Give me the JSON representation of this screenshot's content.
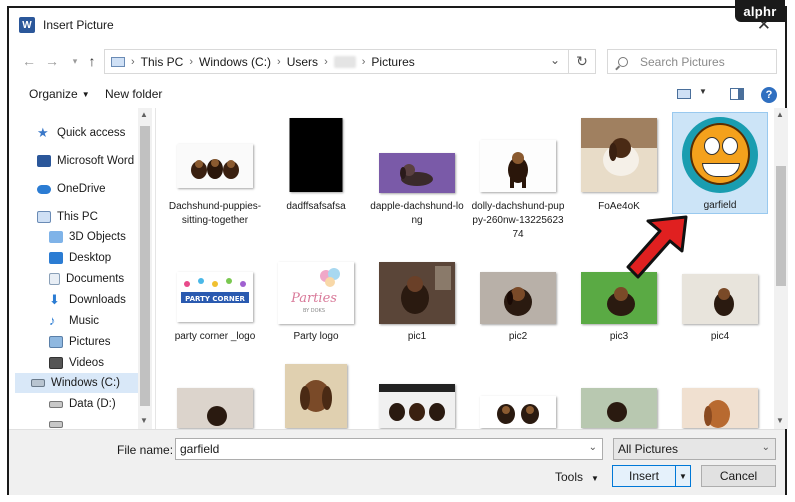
{
  "window": {
    "title": "Insert Picture",
    "app_icon": "word-icon",
    "app_icon_letter": "W"
  },
  "brand": "alphr",
  "nav": {
    "breadcrumb": [
      "This PC",
      "Windows (C:)",
      "Users",
      "Pictures"
    ],
    "search_placeholder": "Search Pictures"
  },
  "toolbar": {
    "organize": "Organize",
    "new_folder": "New folder"
  },
  "sidebar": {
    "items": [
      {
        "label": "Quick access",
        "icon": "star-icon"
      },
      {
        "label": "Microsoft Word",
        "icon": "word-icon"
      },
      {
        "label": "OneDrive",
        "icon": "cloud-icon"
      },
      {
        "label": "This PC",
        "icon": "computer-icon"
      },
      {
        "label": "3D Objects",
        "icon": "cube-icon"
      },
      {
        "label": "Desktop",
        "icon": "desktop-icon"
      },
      {
        "label": "Documents",
        "icon": "documents-icon"
      },
      {
        "label": "Downloads",
        "icon": "downloads-icon"
      },
      {
        "label": "Music",
        "icon": "music-icon"
      },
      {
        "label": "Pictures",
        "icon": "pictures-icon"
      },
      {
        "label": "Videos",
        "icon": "videos-icon"
      },
      {
        "label": "Windows (C:)",
        "icon": "drive-icon",
        "selected": true
      },
      {
        "label": "Data (D:)",
        "icon": "drive-icon"
      }
    ]
  },
  "files": [
    {
      "name": "Dachshund-puppies-sitting-together"
    },
    {
      "name": "dadffsafsafsa"
    },
    {
      "name": "dapple-dachshund-long"
    },
    {
      "name": "dolly-dachshund-puppy-260nw-1322562374"
    },
    {
      "name": "FoAe4oK"
    },
    {
      "name": "garfield",
      "selected": true
    },
    {
      "name": "party corner _logo"
    },
    {
      "name": "Party logo"
    },
    {
      "name": "pic1"
    },
    {
      "name": "pic2"
    },
    {
      "name": "pic3"
    },
    {
      "name": "pic4"
    },
    {
      "name": ""
    },
    {
      "name": ""
    },
    {
      "name": ""
    },
    {
      "name": ""
    },
    {
      "name": ""
    },
    {
      "name": ""
    }
  ],
  "thumb_text": {
    "party_corner": "PARTY CORNER",
    "party_logo": "Parties",
    "party_logo_sub": "BY DOKS"
  },
  "footer": {
    "file_name_label": "File name:",
    "file_name_value": "garfield",
    "filter": "All Pictures",
    "tools": "Tools",
    "insert": "Insert",
    "cancel": "Cancel"
  },
  "colors": {
    "accent": "#0078d7",
    "selection": "#cce4f7",
    "arrow": "#e02020"
  }
}
